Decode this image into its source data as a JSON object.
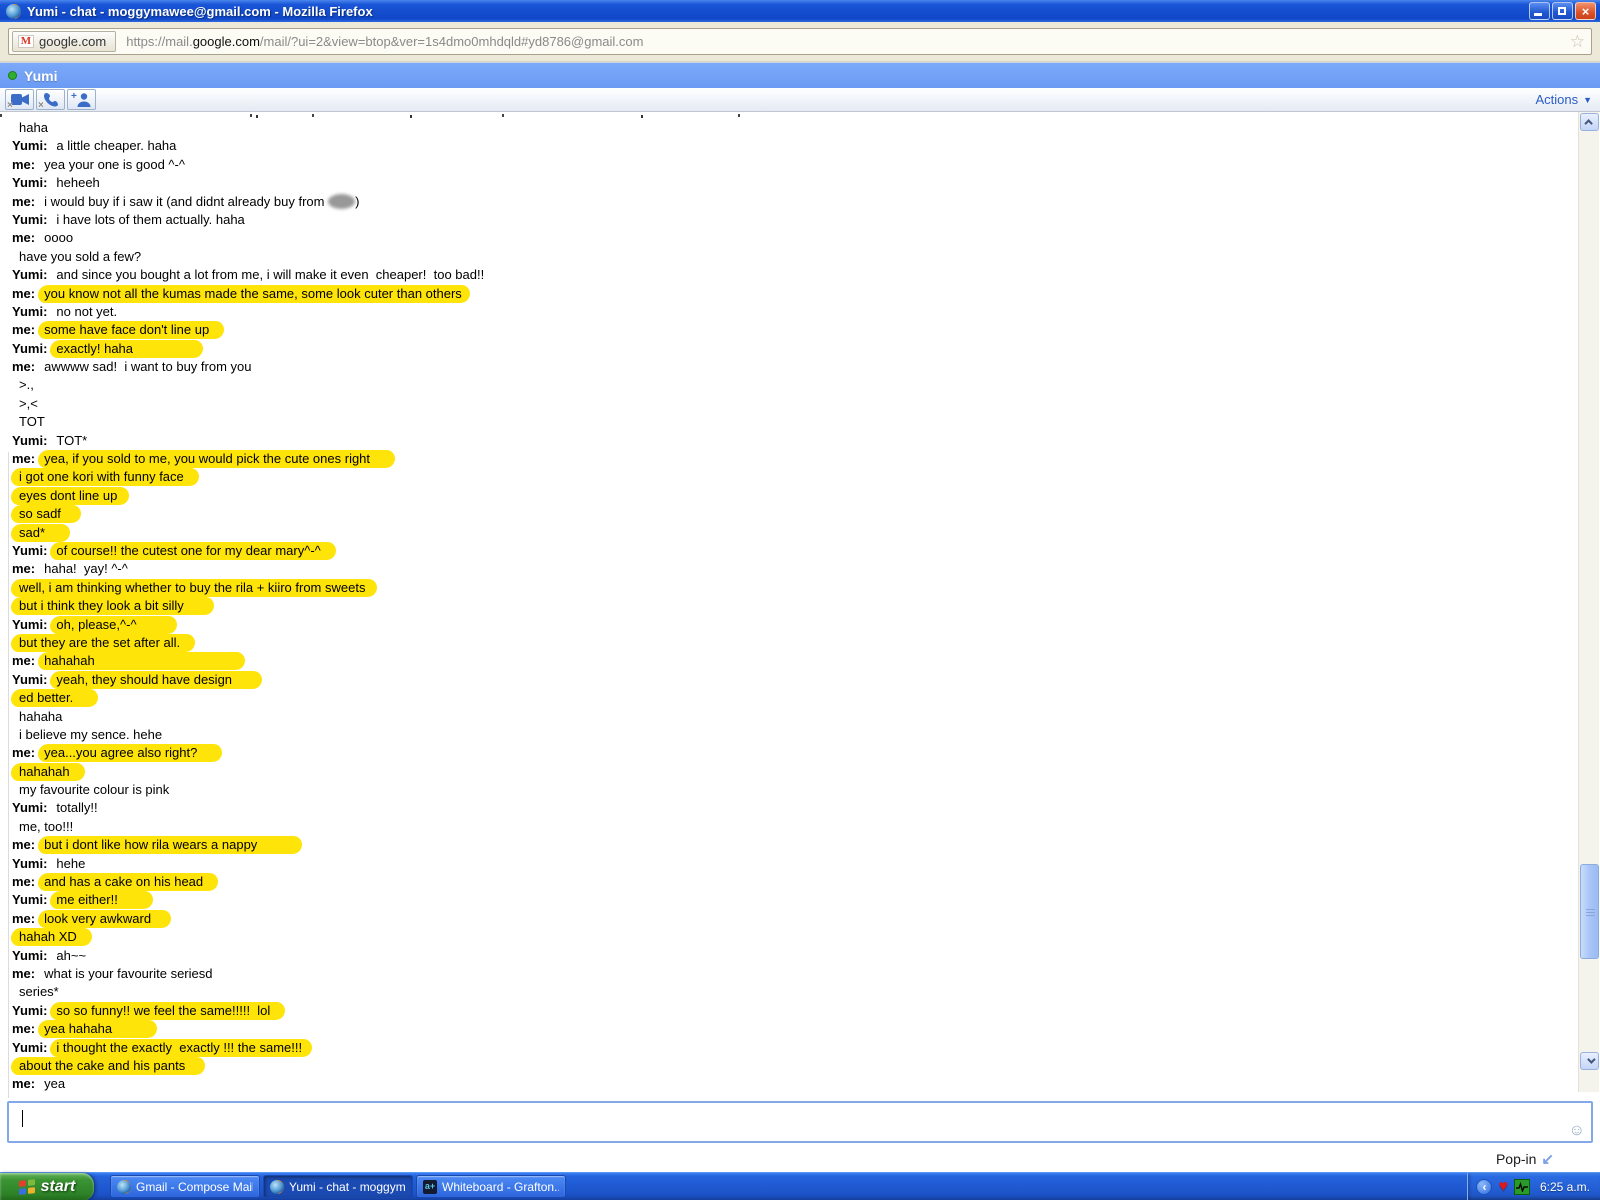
{
  "window": {
    "title": "Yumi - chat - moggymawee@gmail.com - Mozilla Firefox"
  },
  "urlbar": {
    "chip_label": "google.com",
    "url_prefix": "https://mail.",
    "url_domain": "google.com",
    "url_rest": "/mail/?ui=2&view=btop&ver=1s4dmo0mhdqld#yd8786@gmail.com"
  },
  "chat": {
    "contact_name": "Yumi",
    "presence": "online",
    "actions_label": "Actions",
    "toolbar_icons": [
      "video-chat-unavailable-icon",
      "voice-call-unavailable-icon",
      "add-person-icon"
    ],
    "highlight_color": "#ffe40a",
    "messages": [
      {
        "l": "",
        "t": "haha"
      },
      {
        "l": "Yumi:",
        "t": "a little cheaper. haha"
      },
      {
        "l": "me:",
        "t": "yea your one is good ^-^"
      },
      {
        "l": "Yumi:",
        "t": "heheeh"
      },
      {
        "l": "me:",
        "t": "i would buy if i saw it (and didnt already buy from ",
        "blur": true,
        "after": ")"
      },
      {
        "l": "Yumi:",
        "t": "i have lots of them actually. haha"
      },
      {
        "l": "me:",
        "t": "oooo"
      },
      {
        "l": "",
        "t": "have you sold a few?"
      },
      {
        "l": "Yumi:",
        "t": "and since you bought a lot from me, i will make it even  cheaper!  too bad!!"
      },
      {
        "l": "me:",
        "t": "you know not all the kumas made the same, some look cuter than others",
        "h": true,
        "p": 8
      },
      {
        "l": "Yumi:",
        "t": "no not yet."
      },
      {
        "l": "me:",
        "t": "some have face don't line up",
        "h": true,
        "p": 15
      },
      {
        "l": "Yumi:",
        "t": "exactly! haha",
        "h": true,
        "p": 70
      },
      {
        "l": "me:",
        "t": "awwww sad!  i want to buy from you"
      },
      {
        "l": "",
        "t": ">.,"
      },
      {
        "l": "",
        "t": ">,<"
      },
      {
        "l": "",
        "t": "TOT"
      },
      {
        "l": "Yumi:",
        "t": "TOT*"
      },
      {
        "l": "me:",
        "t": "yea, if you sold to me, you would pick the cute ones right",
        "h": true,
        "p": 25
      },
      {
        "l": "",
        "t": "i got one kori with funny face",
        "h": true,
        "p": 15
      },
      {
        "l": "",
        "t": "eyes dont line up",
        "h": true,
        "p": 12
      },
      {
        "l": "",
        "t": "so sadf",
        "h": true,
        "p": 20
      },
      {
        "l": "",
        "t": "sad*",
        "h": true,
        "p": 25
      },
      {
        "l": "Yumi:",
        "t": "of course!! the cutest one for my dear mary^-^",
        "h": true,
        "p": 15
      },
      {
        "l": "me:",
        "t": "haha!  yay! ^-^"
      },
      {
        "l": "",
        "t": "well, i am thinking whether to buy the rila + kiiro from sweets",
        "h": true,
        "p": 12
      },
      {
        "l": "",
        "t": "but i think they look a bit silly",
        "h": true,
        "p": 30
      },
      {
        "l": "Yumi:",
        "t": "oh, please,^-^",
        "h": true,
        "p": 40
      },
      {
        "l": "",
        "t": "but they are the set after all.",
        "h": true,
        "p": 15
      },
      {
        "l": "me:",
        "t": "hahahah",
        "h": true,
        "p": 150
      },
      {
        "l": "Yumi:",
        "t": "yeah, they should have design",
        "h": true,
        "p": 30
      },
      {
        "l": "",
        "t": "ed better.",
        "h": true,
        "p": 25
      },
      {
        "l": "",
        "t": "hahaha"
      },
      {
        "l": "",
        "t": "i believe my sence. hehe"
      },
      {
        "l": "me:",
        "t": "yea...you agree also right?",
        "h": true,
        "p": 25
      },
      {
        "l": "",
        "t": "hahahah",
        "h": true,
        "p": 15
      },
      {
        "l": "",
        "t": "my favourite colour is pink"
      },
      {
        "l": "Yumi:",
        "t": "totally!!"
      },
      {
        "l": "",
        "t": "me, too!!!"
      },
      {
        "l": "me:",
        "t": "but i dont like how rila wears a nappy",
        "h": true,
        "p": 45
      },
      {
        "l": "Yumi:",
        "t": "hehe"
      },
      {
        "l": "me:",
        "t": "and has a cake on his head",
        "h": true,
        "p": 15
      },
      {
        "l": "Yumi:",
        "t": "me either!!",
        "h": true,
        "p": 35
      },
      {
        "l": "me:",
        "t": "look very awkward",
        "h": true,
        "p": 20
      },
      {
        "l": "",
        "t": "hahah XD",
        "h": true,
        "p": 15
      },
      {
        "l": "Yumi:",
        "t": "ah~~"
      },
      {
        "l": "me:",
        "t": "what is your favourite seriesd"
      },
      {
        "l": "",
        "t": "series*"
      },
      {
        "l": "Yumi:",
        "t": "so so funny!! we feel the same!!!!!  lol",
        "h": true,
        "p": 15
      },
      {
        "l": "me:",
        "t": "yea hahaha",
        "h": true,
        "p": 45
      },
      {
        "l": "Yumi:",
        "t": "i thought the exactly  exactly !!! the same!!!",
        "h": true,
        "p": 10
      },
      {
        "l": "",
        "t": "about the cake and his pants",
        "h": true,
        "p": 20
      },
      {
        "l": "me:",
        "t": "yea"
      }
    ]
  },
  "composer": {
    "value": "",
    "popin_label": "Pop-in"
  },
  "taskbar": {
    "start_label": "start",
    "tasks": [
      {
        "label": "Gmail - Compose Mail ...",
        "icon": "firefox",
        "active": false
      },
      {
        "label": "Yumi - chat - moggym...",
        "icon": "firefox",
        "active": true
      },
      {
        "label": "Whiteboard - Grafton...",
        "icon": "whiteboard",
        "active": false
      }
    ],
    "clock": "6:25 a.m."
  }
}
